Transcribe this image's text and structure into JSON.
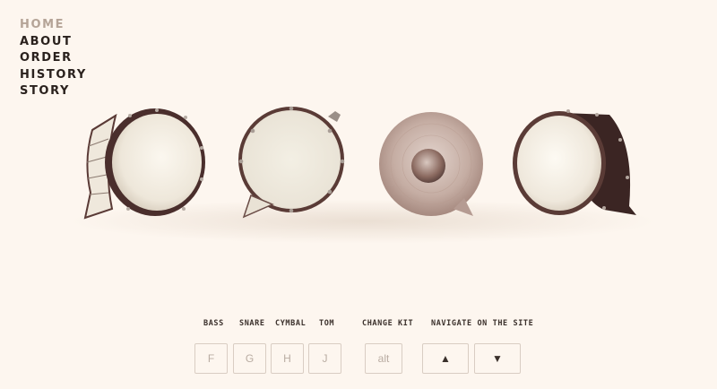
{
  "nav": {
    "items": [
      {
        "label": "HOME",
        "active": true
      },
      {
        "label": "ABOUT",
        "active": false
      },
      {
        "label": "ORDER",
        "active": false
      },
      {
        "label": "HISTORY",
        "active": false
      },
      {
        "label": "STORY",
        "active": false
      }
    ]
  },
  "drums": [
    "bass-drum",
    "snare-drum",
    "cymbal",
    "tom-drum"
  ],
  "controls": {
    "labels": {
      "bass": "BASS",
      "snare": "SNARE",
      "cymbal": "CYMBAL",
      "tom": "TOM",
      "change_kit": "CHANGE KIT",
      "navigate": "NAVIGATE ON THE SITE"
    },
    "keys": {
      "bass": "F",
      "snare": "G",
      "cymbal": "H",
      "tom": "J",
      "change_kit": "alt",
      "up": "▲",
      "down": "▼"
    }
  },
  "colors": {
    "background": "#fdf6ef",
    "nav_active": "#b5a497",
    "nav_text": "#2a211d",
    "key_border": "#d9cdc3"
  }
}
